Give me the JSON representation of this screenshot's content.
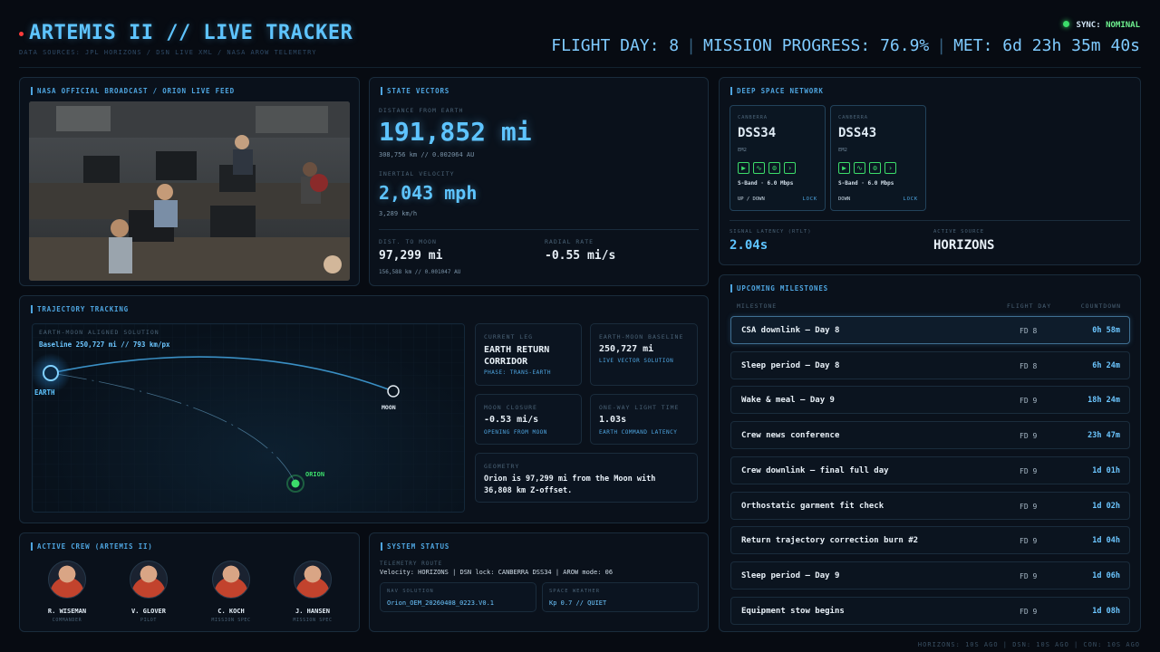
{
  "header": {
    "title": "ARTEMIS II // LIVE TRACKER",
    "subtitle": "DATA SOURCES: JPL HORIZONS / DSN LIVE XML / NASA AROW TELEMETRY",
    "sync_label": "SYNC:",
    "sync_status": "NOMINAL",
    "flight_day": "FLIGHT DAY: 8",
    "mission_progress": "MISSION PROGRESS: 76.9%",
    "met": "MET: 6d 23h 35m 40s"
  },
  "broadcast": {
    "title": "NASA OFFICIAL BROADCAST / ORION LIVE FEED"
  },
  "state_vectors": {
    "title": "STATE VECTORS",
    "dist_label": "DISTANCE FROM EARTH",
    "dist_value": "191,852 mi",
    "dist_sub": "308,756 km // 0.002064 AU",
    "vel_label": "INERTIAL VELOCITY",
    "vel_value": "2,043 mph",
    "vel_sub": "3,289 km/h",
    "moon_label": "DIST. TO MOON",
    "moon_value": "97,299 mi",
    "moon_sub": "156,588 km // 0.001047 AU",
    "radial_label": "RADIAL RATE",
    "radial_value": "-0.55 mi/s"
  },
  "dsn": {
    "title": "DEEP SPACE NETWORK",
    "stations": [
      {
        "location": "CANBERRA",
        "id": "DSS34",
        "em": "EM2",
        "band": "S-Band · 6.0 Mbps",
        "direction": "UP / DOWN",
        "lock": "LOCK"
      },
      {
        "location": "CANBERRA",
        "id": "DSS43",
        "em": "EM2",
        "band": "S-Band · 6.0 Mbps",
        "direction": "DOWN",
        "lock": "LOCK"
      }
    ],
    "latency_label": "SIGNAL LATENCY (RTLT)",
    "latency_value": "2.04s",
    "source_label": "ACTIVE SOURCE",
    "source_value": "HORIZONS"
  },
  "trajectory": {
    "title": "TRAJECTORY TRACKING",
    "solution_label": "EARTH-MOON ALIGNED SOLUTION",
    "baseline": "Baseline 250,727 mi // 793 km/px",
    "earth_label": "EARTH",
    "moon_label": "MOON",
    "orion_label": "ORION",
    "cards": {
      "leg_label": "CURRENT LEG",
      "leg_value": "EARTH RETURN CORRIDOR",
      "leg_sub": "PHASE: TRANS-EARTH",
      "baseline_label": "EARTH-MOON BASELINE",
      "baseline_value": "250,727 mi",
      "baseline_sub": "LIVE VECTOR SOLUTION",
      "closure_label": "MOON CLOSURE",
      "closure_value": "-0.53 mi/s",
      "closure_sub": "OPENING FROM MOON",
      "light_label": "ONE-WAY LIGHT TIME",
      "light_value": "1.03s",
      "light_sub": "EARTH COMMAND LATENCY",
      "geometry_label": "GEOMETRY",
      "geometry_value": "Orion is 97,299 mi from the Moon with 36,808 km Z-offset."
    }
  },
  "crew": {
    "title": "ACTIVE CREW (ARTEMIS II)",
    "members": [
      {
        "name": "R. WISEMAN",
        "role": "COMMANDER"
      },
      {
        "name": "V. GLOVER",
        "role": "PILOT"
      },
      {
        "name": "C. KOCH",
        "role": "MISSION SPEC"
      },
      {
        "name": "J. HANSEN",
        "role": "MISSION SPEC"
      }
    ]
  },
  "system": {
    "title": "SYSTEM STATUS",
    "route_label": "TELEMETRY ROUTE",
    "route_value": "Velocity: HORIZONS | DSN lock: CANBERRA DSS34 | AROW mode: 06",
    "nav_label": "NAV SOLUTION",
    "nav_value": "Orion_OEM_20260408_0223.V0.1",
    "weather_label": "SPACE WEATHER",
    "weather_value": "Kp 0.7 // QUIET"
  },
  "milestones": {
    "title": "UPCOMING MILESTONES",
    "col_milestone": "MILESTONE",
    "col_day": "FLIGHT DAY",
    "col_countdown": "COUNTDOWN",
    "items": [
      {
        "name": "CSA downlink — Day 8",
        "fd": "FD 8",
        "countdown": "0h 58m"
      },
      {
        "name": "Sleep period — Day 8",
        "fd": "FD 8",
        "countdown": "6h 24m"
      },
      {
        "name": "Wake & meal — Day 9",
        "fd": "FD 9",
        "countdown": "18h 24m"
      },
      {
        "name": "Crew news conference",
        "fd": "FD 9",
        "countdown": "23h 47m"
      },
      {
        "name": "Crew downlink — final full day",
        "fd": "FD 9",
        "countdown": "1d 01h"
      },
      {
        "name": "Orthostatic garment fit check",
        "fd": "FD 9",
        "countdown": "1d 02h"
      },
      {
        "name": "Return trajectory correction burn #2",
        "fd": "FD 9",
        "countdown": "1d 04h"
      },
      {
        "name": "Sleep period — Day 9",
        "fd": "FD 9",
        "countdown": "1d 06h"
      },
      {
        "name": "Equipment stow begins",
        "fd": "FD 9",
        "countdown": "1d 08h"
      }
    ]
  },
  "footer": "HORIZONS: 10S AGO | DSN: 10S AGO | CON: 10S AGO",
  "colors": {
    "accent": "#5ec4ff",
    "ok": "#3cdc6a",
    "bg": "#070b12",
    "panel": "#0a111b"
  }
}
